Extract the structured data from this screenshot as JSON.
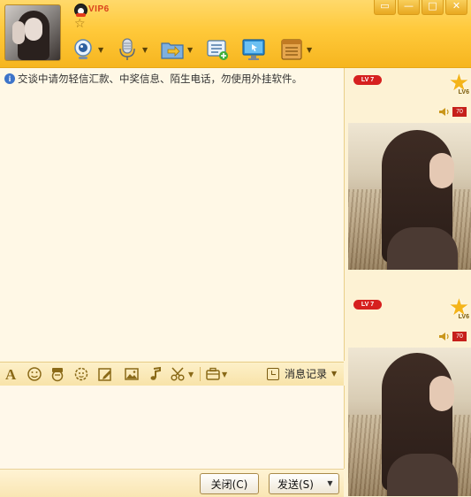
{
  "header": {
    "vip_label": "VIP6",
    "window_controls": [
      "▭",
      "—",
      "□",
      "✕"
    ],
    "toolbar": [
      {
        "name": "video-call",
        "icon": "webcam-icon",
        "has_dropdown": true
      },
      {
        "name": "voice-call",
        "icon": "microphone-icon",
        "has_dropdown": true
      },
      {
        "name": "send-file",
        "icon": "folder-transfer-icon",
        "has_dropdown": true
      },
      {
        "name": "create-group",
        "icon": "chat-list-add-icon",
        "has_dropdown": false
      },
      {
        "name": "remote-assist",
        "icon": "monitor-icon",
        "has_dropdown": false
      },
      {
        "name": "apps",
        "icon": "app-box-icon",
        "has_dropdown": true
      }
    ]
  },
  "chat": {
    "notice": "交谈中请勿轻信汇款、中奖信息、陌生电话，勿使用外挂软件。",
    "info_icon_text": "i"
  },
  "format_toolbar": {
    "history_label": "消息记录"
  },
  "buttons": {
    "close_label": "关闭(C)",
    "send_label": "发送(S)"
  },
  "side_panel": {
    "cards": [
      {
        "lv_badge": "LV 7",
        "level_tag": "LV6",
        "volume": "70"
      },
      {
        "lv_badge": "LV 7",
        "level_tag": "LV6",
        "volume": "70"
      }
    ]
  },
  "colors": {
    "header_gold": "#ffc93a",
    "chat_bg": "#fff8e6",
    "badge_red": "#d6201f",
    "star_gold": "#f4b41a"
  }
}
